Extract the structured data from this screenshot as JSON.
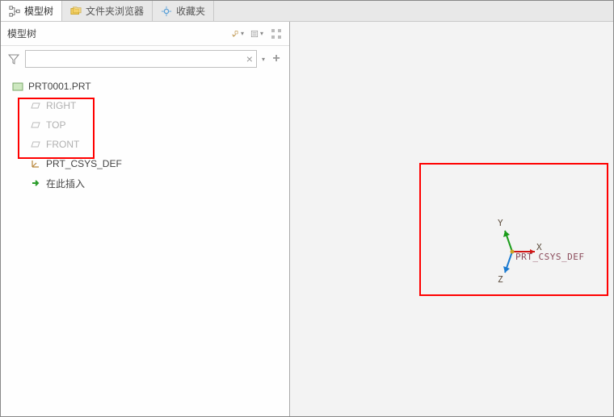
{
  "tabs": {
    "model_tree": "模型树",
    "folder_browser": "文件夹浏览器",
    "favorites": "收藏夹"
  },
  "toolbar": {
    "panel_title": "模型树"
  },
  "filter": {
    "placeholder": ""
  },
  "tree": {
    "root": "PRT0001.PRT",
    "plane_right": "RIGHT",
    "plane_top": "TOP",
    "plane_front": "FRONT",
    "csys": "PRT_CSYS_DEF",
    "insert_here": "在此插入"
  },
  "viewport": {
    "csys_label": "PRT_CSYS_DEF",
    "axis_x": "X",
    "axis_y": "Y",
    "axis_z": "Z"
  }
}
